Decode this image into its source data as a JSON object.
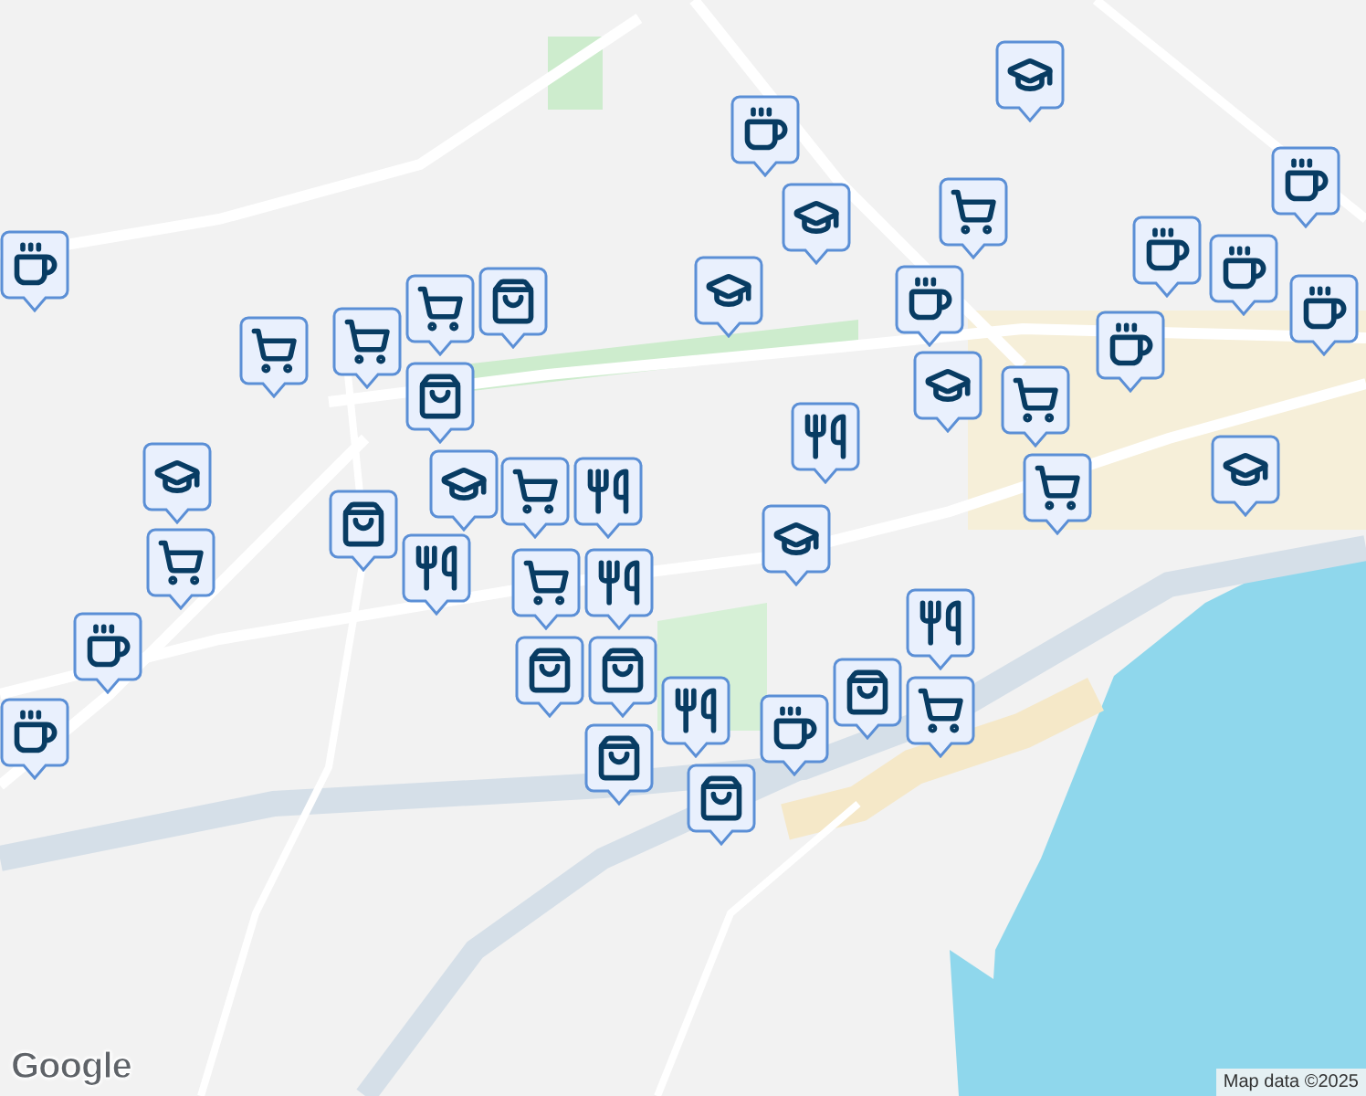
{
  "map": {
    "markers": [
      {
        "kind": "school"
      },
      {
        "kind": "coffee"
      },
      {
        "kind": "coffee"
      },
      {
        "kind": "school"
      },
      {
        "kind": "cart"
      },
      {
        "kind": "coffee"
      },
      {
        "kind": "school"
      },
      {
        "kind": "coffee"
      },
      {
        "kind": "coffee"
      },
      {
        "kind": "coffee"
      },
      {
        "kind": "coffee"
      },
      {
        "kind": "coffee"
      },
      {
        "kind": "bag"
      },
      {
        "kind": "cart"
      },
      {
        "kind": "cart"
      },
      {
        "kind": "cart"
      },
      {
        "kind": "bag"
      },
      {
        "kind": "school"
      },
      {
        "kind": "restaurant"
      },
      {
        "kind": "cart"
      },
      {
        "kind": "cart"
      },
      {
        "kind": "school"
      },
      {
        "kind": "school"
      },
      {
        "kind": "school"
      },
      {
        "kind": "cart"
      },
      {
        "kind": "restaurant"
      },
      {
        "kind": "bag"
      },
      {
        "kind": "restaurant"
      },
      {
        "kind": "school"
      },
      {
        "kind": "cart"
      },
      {
        "kind": "coffee"
      },
      {
        "kind": "cart"
      },
      {
        "kind": "restaurant"
      },
      {
        "kind": "restaurant"
      },
      {
        "kind": "bag"
      },
      {
        "kind": "cart"
      },
      {
        "kind": "bag"
      },
      {
        "kind": "bag"
      },
      {
        "kind": "coffee"
      },
      {
        "kind": "restaurant"
      },
      {
        "kind": "coffee"
      },
      {
        "kind": "bag"
      },
      {
        "kind": "bag"
      }
    ]
  },
  "logo": "Google",
  "attribution": "Map data ©2025"
}
